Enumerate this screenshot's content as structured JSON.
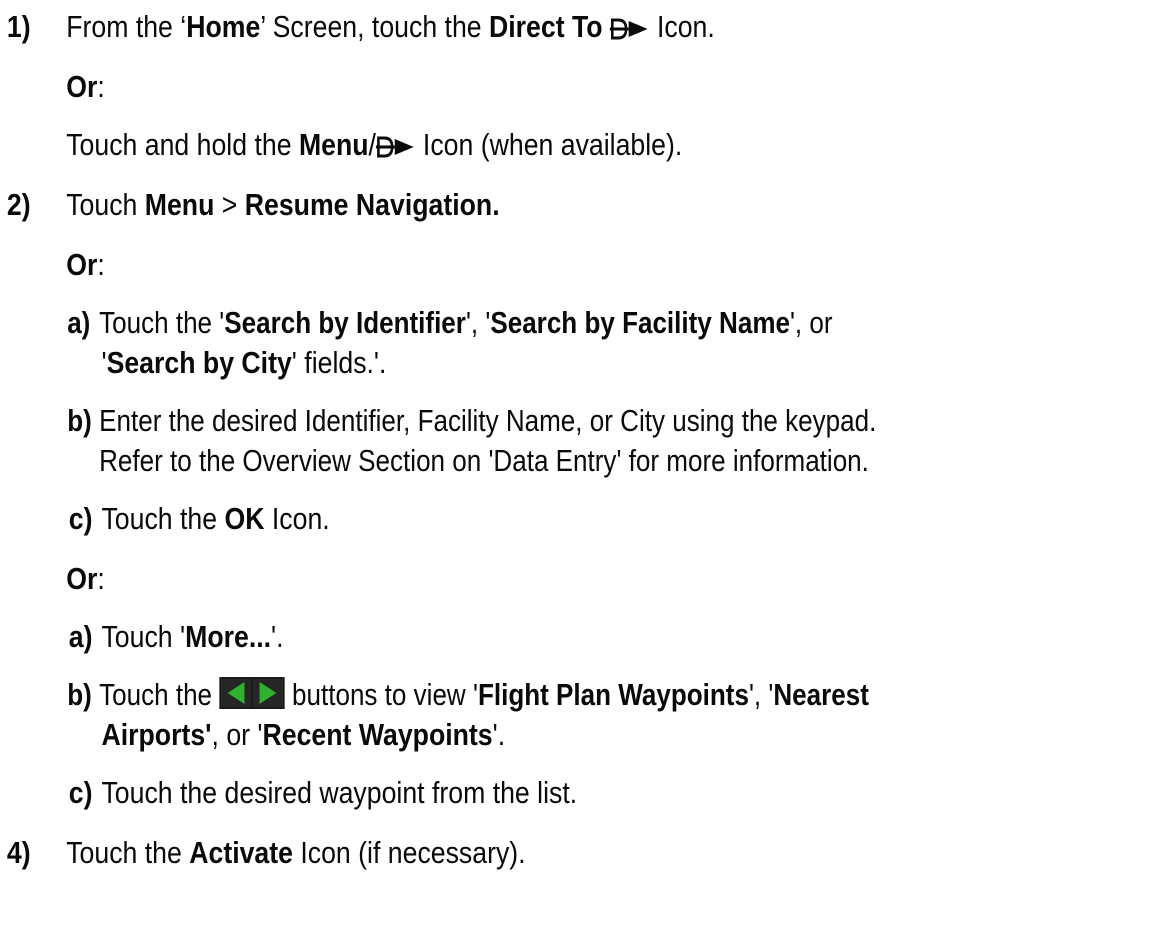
{
  "steps": {
    "s1": {
      "num": "1)",
      "t1": "From the ‘",
      "home": "Home",
      "t2": "’ Screen, touch the ",
      "direct_to": "Direct To",
      "t3": " Icon."
    },
    "or1": {
      "or": "Or",
      "colon": ":"
    },
    "s1b": {
      "t1": "Touch and hold the ",
      "menu": "Menu",
      "slash": "/",
      "t2": " Icon (when available)."
    },
    "s2": {
      "num": "2)",
      "t1": "Touch ",
      "menu": "Menu",
      "sep": " > ",
      "resume": "Resume Navigation."
    },
    "or2": {
      "or": "Or",
      "colon": ":"
    },
    "a1": {
      "label": "a)",
      "t1": "Touch the '",
      "search_id": "Search by Identifier",
      "t2": "', '",
      "search_fac": "Search by Facility Name",
      "t3": "', or",
      "t4": "'",
      "search_city": "Search by City",
      "t5": "' fields.'."
    },
    "b1": {
      "label": "b)",
      "line1": "Enter the desired Identifier, Facility Name, or City using the keypad.",
      "line2": "Refer to the Overview Section on 'Data Entry' for more information."
    },
    "c1": {
      "label": "c)",
      "t1": "Touch the ",
      "ok": "OK",
      "t2": " Icon."
    },
    "or3": {
      "or": "Or",
      "colon": ":"
    },
    "a2": {
      "label": "a)",
      "t1": "Touch '",
      "more": "More...",
      "t2": "'."
    },
    "b2": {
      "label": "b)",
      "t1": "Touch the ",
      "t2": " buttons to view '",
      "fpw": "Flight Plan Waypoints",
      "t3": "', '",
      "nearest": "Nearest",
      "airports": "Airports'",
      "t4": ", or '",
      "recent": "Recent Waypoints",
      "t5": "'."
    },
    "c2": {
      "label": "c)",
      "text": "Touch the desired waypoint from the list."
    },
    "s4": {
      "num": "4)",
      "t1": "Touch the ",
      "activate": "Activate",
      "t2": " Icon (if necessary)."
    }
  },
  "icons": {
    "direct_to": "direct-to-icon",
    "arrow_buttons": "left-right-arrow-buttons-icon",
    "arrow_button_color": "#2fb12f"
  }
}
